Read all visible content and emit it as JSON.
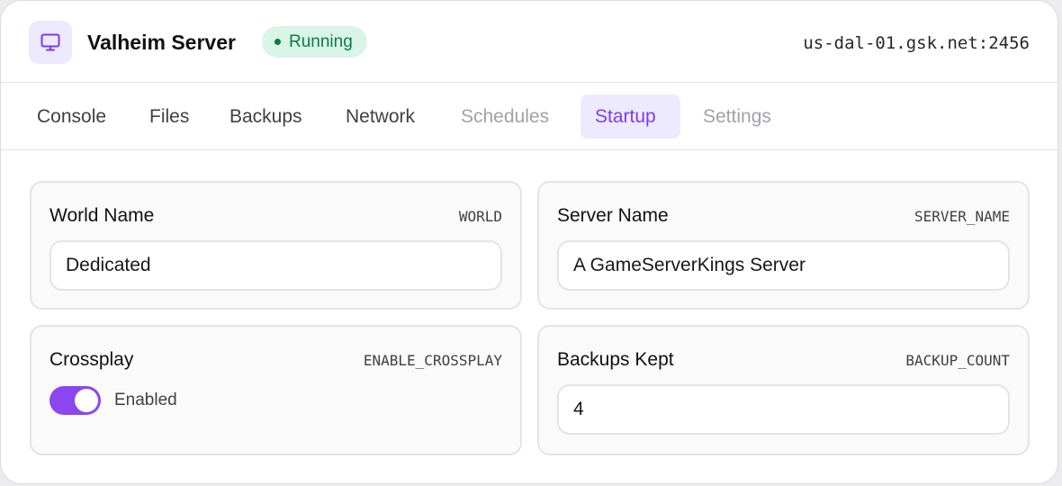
{
  "header": {
    "icon": "monitor-icon",
    "title": "Valheim Server",
    "status": "Running",
    "address": "us-dal-01.gsk.net:2456"
  },
  "tabs": [
    {
      "label": "Console",
      "state": "normal"
    },
    {
      "label": "Files",
      "state": "normal"
    },
    {
      "label": "Backups",
      "state": "normal"
    },
    {
      "label": "Network",
      "state": "normal"
    },
    {
      "label": "Schedules",
      "state": "disabled"
    },
    {
      "label": "Startup",
      "state": "active"
    },
    {
      "label": "Settings",
      "state": "disabled"
    }
  ],
  "variables": {
    "world_name": {
      "label": "World Name",
      "key": "WORLD",
      "value": "Dedicated"
    },
    "server_name": {
      "label": "Server Name",
      "key": "SERVER_NAME",
      "value": "A GameServerKings Server"
    },
    "crossplay": {
      "label": "Crossplay",
      "key": "ENABLE_CROSSPLAY",
      "value_label": "Enabled",
      "enabled": true
    },
    "backups_kept": {
      "label": "Backups Kept",
      "key": "BACKUP_COUNT",
      "value": "4"
    }
  },
  "colors": {
    "accent": "#8b46f0",
    "accent_soft": "#ede9fe",
    "status_bg": "#d8f5e7",
    "status_text": "#0d7a4c"
  }
}
